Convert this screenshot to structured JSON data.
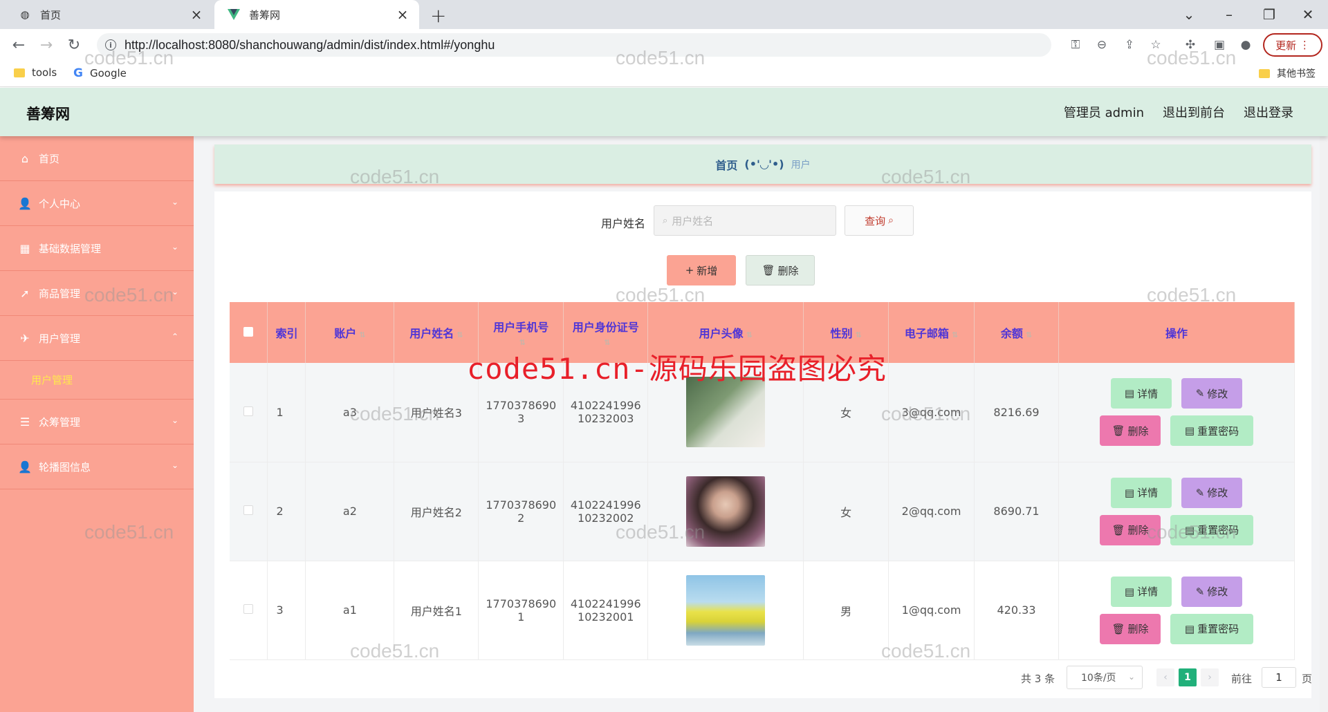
{
  "browser": {
    "tabs": [
      {
        "title": "首页",
        "active": false
      },
      {
        "title": "善筹网",
        "active": true
      }
    ],
    "new_tab": "+",
    "url": "http://localhost:8080/shanchouwang/admin/dist/index.html#/yonghu",
    "update_label": "更新",
    "bookmarks": [
      {
        "label": "tools",
        "icon": "folder-icon"
      },
      {
        "label": "Google",
        "icon": "google-icon"
      }
    ],
    "other_bookmarks": "其他书签"
  },
  "header": {
    "title": "善筹网",
    "links": [
      "管理员 admin",
      "退出到前台",
      "退出登录"
    ]
  },
  "sidebar": {
    "items": [
      {
        "label": "首页",
        "icon": "home-icon",
        "chevron": ""
      },
      {
        "label": "个人中心",
        "icon": "user-icon",
        "chevron": "⌄"
      },
      {
        "label": "基础数据管理",
        "icon": "grid-icon",
        "chevron": "⌄"
      },
      {
        "label": "商品管理",
        "icon": "send-icon",
        "chevron": "⌄"
      },
      {
        "label": "用户管理",
        "icon": "plane-icon",
        "chevron": "⌃"
      },
      {
        "label": "众筹管理",
        "icon": "list-icon",
        "chevron": "⌄"
      },
      {
        "label": "轮播图信息",
        "icon": "user-icon",
        "chevron": "⌄"
      }
    ],
    "submenu": "用户管理"
  },
  "breadcrumb": {
    "home": "首页",
    "separator": "(•'◡'•)",
    "current": "用户"
  },
  "search": {
    "label": "用户姓名",
    "placeholder": "用户姓名",
    "button": "查询"
  },
  "actions": {
    "add": "新增",
    "delete": "删除"
  },
  "table": {
    "columns": [
      "索引",
      "账户",
      "用户姓名",
      "用户手机号",
      "用户身份证号",
      "用户头像",
      "性别",
      "电子邮箱",
      "余额",
      "操作"
    ],
    "rows": [
      {
        "index": "1",
        "account": "a3",
        "name": "用户姓名3",
        "phone": [
          "1770378690",
          "3"
        ],
        "idcard": [
          "4102241996",
          "10232003"
        ],
        "gender": "女",
        "email": "3@qq.com",
        "balance": "8216.69"
      },
      {
        "index": "2",
        "account": "a2",
        "name": "用户姓名2",
        "phone": [
          "1770378690",
          "2"
        ],
        "idcard": [
          "4102241996",
          "10232002"
        ],
        "gender": "女",
        "email": "2@qq.com",
        "balance": "8690.71"
      },
      {
        "index": "3",
        "account": "a1",
        "name": "用户姓名1",
        "phone": [
          "1770378690",
          "1"
        ],
        "idcard": [
          "4102241996",
          "10232001"
        ],
        "gender": "男",
        "email": "1@qq.com",
        "balance": "420.33"
      }
    ],
    "ops": {
      "detail": "详情",
      "edit": "修改",
      "remove": "删除",
      "reset": "重置密码"
    }
  },
  "pagination": {
    "total": "共 3 条",
    "page_size": "10条/页",
    "current": "1",
    "goto": "前往",
    "goto_value": "1",
    "page_suffix": "页"
  },
  "watermark": {
    "small": "code51.cn",
    "big": "code51.cn-源码乐园盗图必究"
  },
  "colors": {
    "sidebar": "#fba393",
    "header": "#daeee3",
    "table_header": "#fba393",
    "header_text": "#4e35d7",
    "detail_button": "#b2ecc5",
    "edit_button": "#c59ee8",
    "delete_button": "#ed78ae",
    "pagination_active": "#21b07a"
  }
}
